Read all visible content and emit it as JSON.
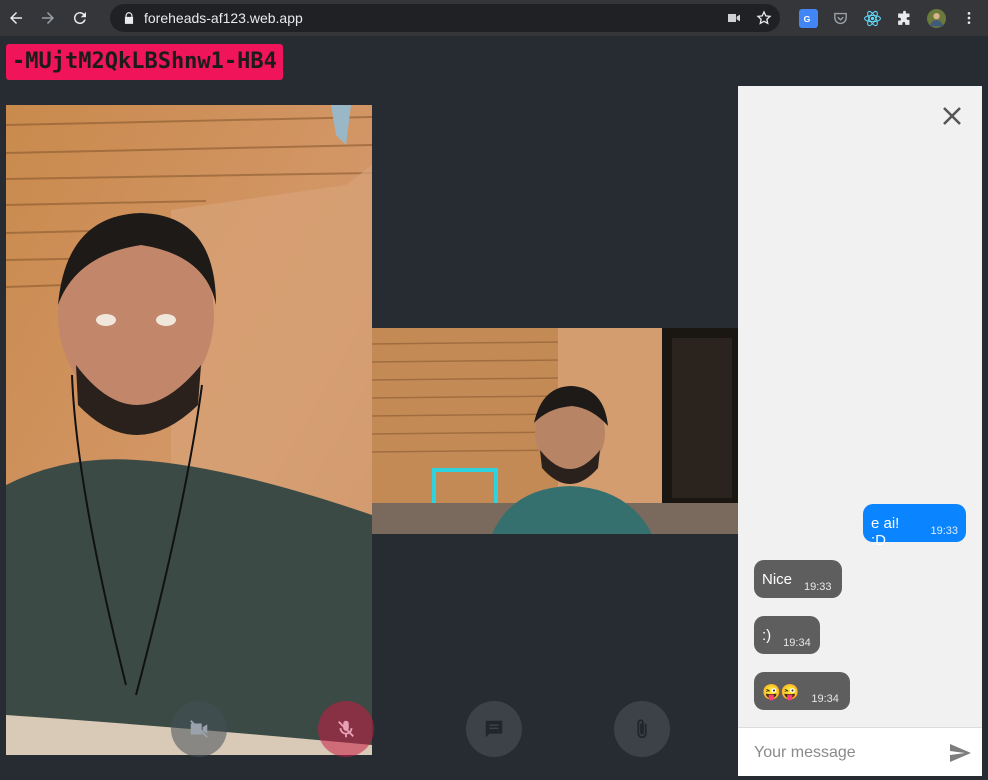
{
  "browser": {
    "url": "foreheads-af123.web.app",
    "nav": [
      "back-icon",
      "forward-icon",
      "reload-icon"
    ],
    "omnibox_icons": [
      "camera-icon",
      "star-icon"
    ],
    "extensions": [
      "google-translate-icon",
      "pocket-icon",
      "react-devtools-icon",
      "puzzle-icon",
      "profile-avatar",
      "menu-dots-icon"
    ]
  },
  "room": {
    "id": "-MUjtM2QkLBShnw1-HB4"
  },
  "controls": {
    "camera": "camera-off-icon",
    "mic": "mic-off-icon",
    "chat": "chat-icon",
    "attach": "paperclip-icon"
  },
  "chat": {
    "close_icon": "close-icon",
    "messages": [
      {
        "direction": "out",
        "text": "e ai! :D",
        "time": "19:33"
      },
      {
        "direction": "in",
        "text": "Nice",
        "time": "19:33"
      },
      {
        "direction": "in",
        "text": ":)",
        "time": "19:34"
      },
      {
        "direction": "in",
        "text": "😜😜",
        "time": "19:34"
      }
    ],
    "input": {
      "placeholder": "Your message",
      "value": ""
    },
    "send_icon": "send-icon"
  },
  "colors": {
    "page_bg": "#272b32",
    "room_badge": "#f0145a",
    "bubble_out": "#0a84ff",
    "bubble_in": "#5e5e5e",
    "chat_bg": "#f1f1f1"
  }
}
